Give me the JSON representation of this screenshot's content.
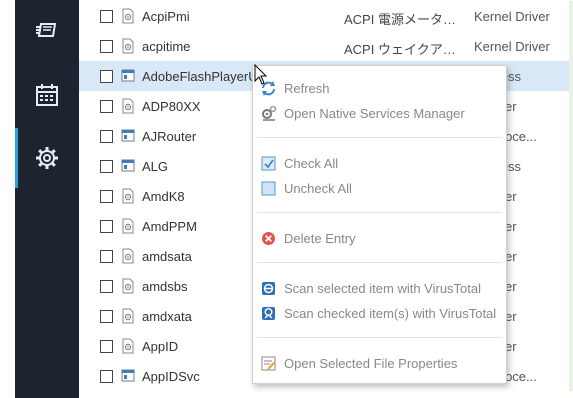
{
  "sidebar": {
    "items": [
      {
        "name": "services-icon",
        "active": false
      },
      {
        "name": "calendar-icon",
        "active": false
      },
      {
        "name": "settings-gear-icon",
        "active": true
      }
    ]
  },
  "services": [
    {
      "name": "AcpiPmi",
      "description": "ACPI 電源メーター ...",
      "type": "Kernel Driver",
      "icon": "driver-file-icon",
      "checked": false,
      "selected": false
    },
    {
      "name": "acpitime",
      "description": "ACPI ウェイクアラー...",
      "type": "Kernel Driver",
      "icon": "driver-file-icon",
      "checked": false,
      "selected": false
    },
    {
      "name": "AdobeFlashPlayerU",
      "description": "",
      "type": "Process",
      "icon": "service-window-icon",
      "checked": false,
      "selected": true
    },
    {
      "name": "ADP80XX",
      "description": "",
      "type": "r Driver",
      "icon": "driver-file-icon",
      "checked": false,
      "selected": false
    },
    {
      "name": "AJRouter",
      "description": "",
      "type": "ed Proce...",
      "icon": "service-window-icon",
      "checked": false,
      "selected": false
    },
    {
      "name": "ALG",
      "description": "",
      "type": "Process",
      "icon": "service-window-icon",
      "checked": false,
      "selected": false
    },
    {
      "name": "AmdK8",
      "description": "",
      "type": "r Driver",
      "icon": "driver-file-icon",
      "checked": false,
      "selected": false
    },
    {
      "name": "AmdPPM",
      "description": "",
      "type": "r Driver",
      "icon": "driver-file-icon",
      "checked": false,
      "selected": false
    },
    {
      "name": "amdsata",
      "description": "",
      "type": "r Driver",
      "icon": "driver-file-icon",
      "checked": false,
      "selected": false
    },
    {
      "name": "amdsbs",
      "description": "",
      "type": "r Driver",
      "icon": "driver-file-icon",
      "checked": false,
      "selected": false
    },
    {
      "name": "amdxata",
      "description": "",
      "type": "r Driver",
      "icon": "driver-file-icon",
      "checked": false,
      "selected": false
    },
    {
      "name": "AppID",
      "description": "",
      "type": "r Driver",
      "icon": "driver-file-icon",
      "checked": false,
      "selected": false
    },
    {
      "name": "AppIDSvc",
      "description": "",
      "type": "ed Proce...",
      "icon": "service-window-icon",
      "checked": false,
      "selected": false
    }
  ],
  "context_menu": {
    "items": [
      {
        "label": "Refresh",
        "icon": "refresh-icon"
      },
      {
        "label": "Open Native Services Manager",
        "icon": "services-manager-icon"
      },
      {
        "label": "Check All",
        "icon": "check-all-icon"
      },
      {
        "label": "Uncheck All",
        "icon": "uncheck-all-icon"
      },
      {
        "label": "Delete Entry",
        "icon": "delete-icon"
      },
      {
        "label": "Scan selected item with VirusTotal",
        "icon": "virustotal-icon"
      },
      {
        "label": "Scan checked item(s) with VirusTotal",
        "icon": "virustotal-upload-icon"
      },
      {
        "label": "Open Selected File Properties",
        "icon": "file-properties-icon"
      }
    ]
  },
  "colors": {
    "sidebar_bg": "#1d2430",
    "accent": "#2aa0d6",
    "selection": "#d8e8f6"
  }
}
